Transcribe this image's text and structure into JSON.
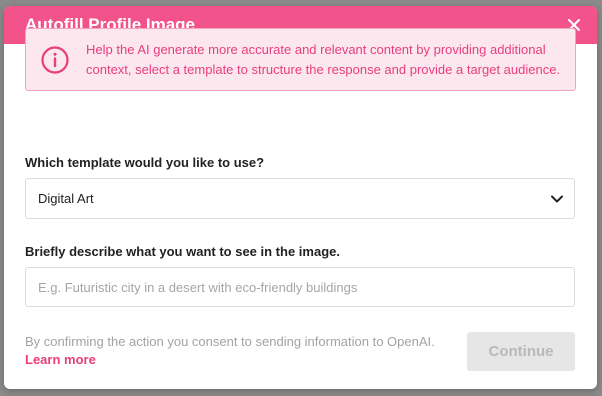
{
  "modal": {
    "title": "Autofill Profile Image",
    "close_icon": "close-icon"
  },
  "alert": {
    "icon": "info-circle-icon",
    "text": "Help the AI generate more accurate and relevant content by providing additional context, select a template to structure the response and provide a target audience."
  },
  "template": {
    "label": "Which template would you like to use?",
    "selected": "Digital Art",
    "icon": "chevron-down-icon"
  },
  "description": {
    "label": "Briefly describe what you want to see in the image.",
    "value": "",
    "placeholder": "E.g. Futuristic city in a desert with eco-friendly buildings"
  },
  "footer": {
    "consent_text": "By confirming the action you consent to sending information to OpenAI.",
    "learn_more": "Learn more",
    "continue_label": "Continue"
  },
  "colors": {
    "accent": "#f2538b",
    "alert_bg": "#fde7ef",
    "alert_text": "#e83e7d",
    "disabled_bg": "#e6e6e6"
  }
}
